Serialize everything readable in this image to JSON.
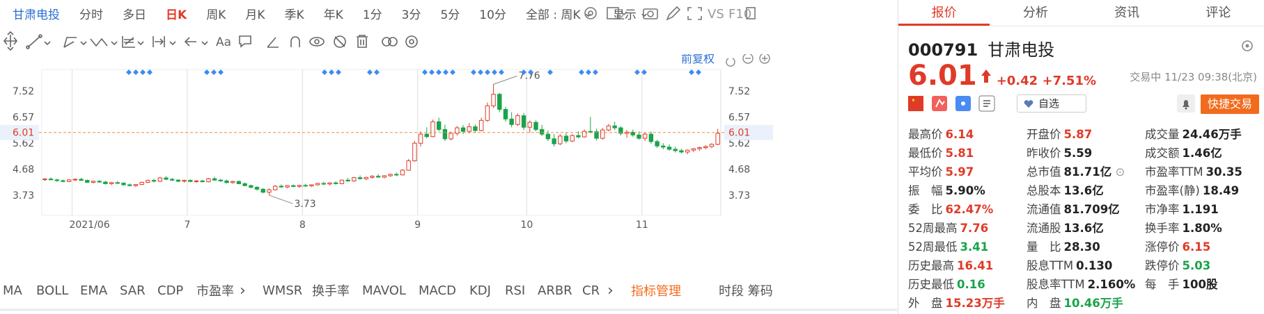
{
  "toolbar": {
    "stock_name": "甘肃电投",
    "periods": [
      "分时",
      "多日",
      "日K",
      "周K",
      "月K",
      "季K",
      "年K",
      "1分",
      "3分",
      "5分",
      "10分"
    ],
    "active_period": "日K",
    "range_select": "全部 : 周K",
    "display_menu": "显示",
    "vs_label": "VS",
    "f10_label": "F10",
    "text_tool": "Aa"
  },
  "chart_header": {
    "adjust_label": "前复权"
  },
  "indicators": [
    "MA",
    "BOLL",
    "EMA",
    "SAR",
    "CDP",
    "市盈率",
    "WMSR",
    "换手率",
    "MAVOL",
    "MACD",
    "KDJ",
    "RSI",
    "ARBR",
    "CR"
  ],
  "indicator_manage": "指标管理",
  "time_share_label": "时段 筹码",
  "chart_data": {
    "type": "candlestick",
    "y_ticks": [
      "7.52",
      "6.57",
      "5.62",
      "4.68",
      "3.73"
    ],
    "x_ticks": [
      "2021/06",
      "7",
      "8",
      "9",
      "10",
      "11"
    ],
    "ylim": [
      3.0,
      8.3
    ],
    "last_price": "6.01",
    "high_label": "7.76",
    "low_label": "3.73",
    "ohlc": [
      [
        4.3,
        4.35,
        4.25,
        4.32
      ],
      [
        4.32,
        4.38,
        4.28,
        4.29
      ],
      [
        4.29,
        4.33,
        4.22,
        4.26
      ],
      [
        4.26,
        4.3,
        4.2,
        4.23
      ],
      [
        4.23,
        4.31,
        4.2,
        4.29
      ],
      [
        4.29,
        4.34,
        4.25,
        4.31
      ],
      [
        4.31,
        4.36,
        4.26,
        4.27
      ],
      [
        4.27,
        4.3,
        4.18,
        4.2
      ],
      [
        4.2,
        4.26,
        4.16,
        4.24
      ],
      [
        4.24,
        4.28,
        4.18,
        4.21
      ],
      [
        4.21,
        4.25,
        4.12,
        4.15
      ],
      [
        4.15,
        4.22,
        4.1,
        4.19
      ],
      [
        4.19,
        4.24,
        4.14,
        4.17
      ],
      [
        4.17,
        4.2,
        4.08,
        4.11
      ],
      [
        4.11,
        4.16,
        4.05,
        4.08
      ],
      [
        4.08,
        4.14,
        4.03,
        4.12
      ],
      [
        4.12,
        4.22,
        4.1,
        4.2
      ],
      [
        4.2,
        4.3,
        4.17,
        4.27
      ],
      [
        4.27,
        4.33,
        4.2,
        4.24
      ],
      [
        4.24,
        4.4,
        4.21,
        4.36
      ],
      [
        4.36,
        4.42,
        4.28,
        4.31
      ],
      [
        4.31,
        4.36,
        4.24,
        4.28
      ],
      [
        4.28,
        4.32,
        4.2,
        4.24
      ],
      [
        4.24,
        4.3,
        4.19,
        4.27
      ],
      [
        4.27,
        4.31,
        4.21,
        4.23
      ],
      [
        4.23,
        4.28,
        4.18,
        4.25
      ],
      [
        4.25,
        4.3,
        4.2,
        4.22
      ],
      [
        4.22,
        4.36,
        4.2,
        4.33
      ],
      [
        4.33,
        4.4,
        4.26,
        4.28
      ],
      [
        4.28,
        4.33,
        4.22,
        4.25
      ],
      [
        4.25,
        4.3,
        4.16,
        4.19
      ],
      [
        4.19,
        4.26,
        4.15,
        4.23
      ],
      [
        4.23,
        4.27,
        4.13,
        4.15
      ],
      [
        4.15,
        4.2,
        4.05,
        4.08
      ],
      [
        4.08,
        4.12,
        3.98,
        4.02
      ],
      [
        4.02,
        4.06,
        3.9,
        3.95
      ],
      [
        3.95,
        3.99,
        3.8,
        3.84
      ],
      [
        3.84,
        3.98,
        3.73,
        3.93
      ],
      [
        3.93,
        4.1,
        3.9,
        4.06
      ],
      [
        4.06,
        4.12,
        4.0,
        4.03
      ],
      [
        4.03,
        4.1,
        3.99,
        4.08
      ],
      [
        4.08,
        4.12,
        4.02,
        4.05
      ],
      [
        4.05,
        4.11,
        4.0,
        4.09
      ],
      [
        4.09,
        4.15,
        4.04,
        4.07
      ],
      [
        4.07,
        4.13,
        4.03,
        4.11
      ],
      [
        4.11,
        4.18,
        4.08,
        4.16
      ],
      [
        4.16,
        4.22,
        4.1,
        4.14
      ],
      [
        4.14,
        4.2,
        4.09,
        4.18
      ],
      [
        4.18,
        4.24,
        4.12,
        4.15
      ],
      [
        4.15,
        4.3,
        4.13,
        4.28
      ],
      [
        4.28,
        4.36,
        4.22,
        4.25
      ],
      [
        4.25,
        4.4,
        4.22,
        4.37
      ],
      [
        4.37,
        4.45,
        4.3,
        4.33
      ],
      [
        4.33,
        4.4,
        4.28,
        4.38
      ],
      [
        4.38,
        4.46,
        4.33,
        4.42
      ],
      [
        4.42,
        4.5,
        4.36,
        4.39
      ],
      [
        4.39,
        4.46,
        4.34,
        4.44
      ],
      [
        4.44,
        4.52,
        4.4,
        4.49
      ],
      [
        4.49,
        4.56,
        4.42,
        4.47
      ],
      [
        4.47,
        4.68,
        4.45,
        4.64
      ],
      [
        4.64,
        5.05,
        4.62,
        4.98
      ],
      [
        4.98,
        5.7,
        4.95,
        5.62
      ],
      [
        5.62,
        6.05,
        5.5,
        5.95
      ],
      [
        5.95,
        6.2,
        5.8,
        5.86
      ],
      [
        5.86,
        6.48,
        5.84,
        6.4
      ],
      [
        6.4,
        6.55,
        6.05,
        6.12
      ],
      [
        6.12,
        6.3,
        5.7,
        5.78
      ],
      [
        5.78,
        6.05,
        5.72,
        5.98
      ],
      [
        5.98,
        6.25,
        5.9,
        6.18
      ],
      [
        6.18,
        6.28,
        5.95,
        6.05
      ],
      [
        6.05,
        6.35,
        5.98,
        6.22
      ],
      [
        6.22,
        6.3,
        6.0,
        6.08
      ],
      [
        6.08,
        6.55,
        6.05,
        6.45
      ],
      [
        6.45,
        7.1,
        6.4,
        6.98
      ],
      [
        6.98,
        7.76,
        6.9,
        7.4
      ],
      [
        7.4,
        7.45,
        6.75,
        6.85
      ],
      [
        6.85,
        6.95,
        6.4,
        6.5
      ],
      [
        6.5,
        6.75,
        6.2,
        6.3
      ],
      [
        6.3,
        6.7,
        6.25,
        6.62
      ],
      [
        6.62,
        6.72,
        6.1,
        6.2
      ],
      [
        6.2,
        6.45,
        6.0,
        6.38
      ],
      [
        6.38,
        6.45,
        6.05,
        6.12
      ],
      [
        6.12,
        6.28,
        5.88,
        5.95
      ],
      [
        5.95,
        6.08,
        5.7,
        5.78
      ],
      [
        5.78,
        5.95,
        5.5,
        5.6
      ],
      [
        5.6,
        5.95,
        5.55,
        5.88
      ],
      [
        5.88,
        6.0,
        5.62,
        5.7
      ],
      [
        5.7,
        5.95,
        5.66,
        5.9
      ],
      [
        5.9,
        6.05,
        5.8,
        5.85
      ],
      [
        5.85,
        6.12,
        5.82,
        6.05
      ],
      [
        6.05,
        6.58,
        5.98,
        6.04
      ],
      [
        6.04,
        6.15,
        5.72,
        5.8
      ],
      [
        5.8,
        6.18,
        5.75,
        6.1
      ],
      [
        6.1,
        6.32,
        6.05,
        6.25
      ],
      [
        6.25,
        6.4,
        6.1,
        6.18
      ],
      [
        6.18,
        6.24,
        5.9,
        5.98
      ],
      [
        5.98,
        6.1,
        5.82,
        6.02
      ],
      [
        6.02,
        6.12,
        5.85,
        5.92
      ],
      [
        5.92,
        6.05,
        5.75,
        5.8
      ],
      [
        5.8,
        6.0,
        5.7,
        5.95
      ],
      [
        5.95,
        6.05,
        5.6,
        5.68
      ],
      [
        5.68,
        5.75,
        5.45,
        5.52
      ],
      [
        5.52,
        5.62,
        5.4,
        5.48
      ],
      [
        5.48,
        5.58,
        5.35,
        5.4
      ],
      [
        5.4,
        5.5,
        5.28,
        5.35
      ],
      [
        5.35,
        5.42,
        5.25,
        5.3
      ],
      [
        5.3,
        5.4,
        5.22,
        5.37
      ],
      [
        5.37,
        5.45,
        5.3,
        5.42
      ],
      [
        5.42,
        5.5,
        5.35,
        5.46
      ],
      [
        5.46,
        5.55,
        5.4,
        5.5
      ],
      [
        5.5,
        5.62,
        5.45,
        5.58
      ],
      [
        5.58,
        6.14,
        5.55,
        5.98
      ]
    ],
    "marker_groups": [
      [
        185,
        215
      ],
      [
        297,
        322
      ],
      [
        466,
        495
      ],
      [
        531,
        548
      ],
      [
        610,
        652
      ],
      [
        680,
        729
      ],
      [
        752,
        768
      ],
      [
        790,
        790
      ],
      [
        835,
        862
      ],
      [
        915,
        925
      ],
      [
        993,
        1005
      ]
    ]
  },
  "quote": {
    "tabs": [
      "报价",
      "分析",
      "资讯",
      "评论"
    ],
    "active_tab": "报价",
    "code": "000791",
    "name": "甘肃电投",
    "price": "6.01",
    "change": "+0.42",
    "change_pct": "+7.51%",
    "status": "交易中 11/23 09:38(北京)",
    "fav_label": "自选",
    "quick_trade": "快捷交易",
    "stats": [
      [
        {
          "k": "最高价",
          "v": "6.14",
          "c": "red"
        },
        {
          "k": "开盘价",
          "v": "5.87",
          "c": "red"
        },
        {
          "k": "成交量",
          "v": "24.46万手",
          "c": "dark"
        }
      ],
      [
        {
          "k": "最低价",
          "v": "5.81",
          "c": "red"
        },
        {
          "k": "昨收价",
          "v": "5.59",
          "c": "dark"
        },
        {
          "k": "成交额",
          "v": "1.46亿",
          "c": "dark"
        }
      ],
      [
        {
          "k": "平均价",
          "v": "5.97",
          "c": "red"
        },
        {
          "k": "总市值",
          "v": "81.71亿",
          "c": "dark"
        },
        {
          "k": "市盈率TTM",
          "v": "30.35",
          "c": "dark"
        }
      ],
      [
        {
          "k": "振　幅",
          "v": "5.90%",
          "c": "dark"
        },
        {
          "k": "总股本",
          "v": "13.6亿",
          "c": "dark"
        },
        {
          "k": "市盈率(静)",
          "v": "18.49",
          "c": "dark"
        }
      ],
      [
        {
          "k": "委　比",
          "v": "62.47%",
          "c": "red"
        },
        {
          "k": "流通值",
          "v": "81.709亿",
          "c": "dark"
        },
        {
          "k": "市净率",
          "v": "1.191",
          "c": "dark"
        }
      ],
      [
        {
          "k": "52周最高",
          "v": "7.76",
          "c": "red"
        },
        {
          "k": "流通股",
          "v": "13.6亿",
          "c": "dark"
        },
        {
          "k": "换手率",
          "v": "1.80%",
          "c": "dark"
        }
      ],
      [
        {
          "k": "52周最低",
          "v": "3.41",
          "c": "green"
        },
        {
          "k": "量　比",
          "v": "28.30",
          "c": "dark"
        },
        {
          "k": "涨停价",
          "v": "6.15",
          "c": "red"
        }
      ],
      [
        {
          "k": "历史最高",
          "v": "16.41",
          "c": "red"
        },
        {
          "k": "股息TTM",
          "v": "0.130",
          "c": "dark"
        },
        {
          "k": "跌停价",
          "v": "5.03",
          "c": "green"
        }
      ],
      [
        {
          "k": "历史最低",
          "v": "0.16",
          "c": "green"
        },
        {
          "k": "股息率TTM",
          "v": "2.160%",
          "c": "dark"
        },
        {
          "k": "每　手",
          "v": "100股",
          "c": "dark"
        }
      ],
      [
        {
          "k": "外　盘",
          "v": "15.23万手",
          "c": "red"
        },
        {
          "k": "内　盘",
          "v": "10.46万手",
          "c": "green"
        },
        {
          "k": "",
          "v": "",
          "c": "dark"
        }
      ]
    ]
  }
}
